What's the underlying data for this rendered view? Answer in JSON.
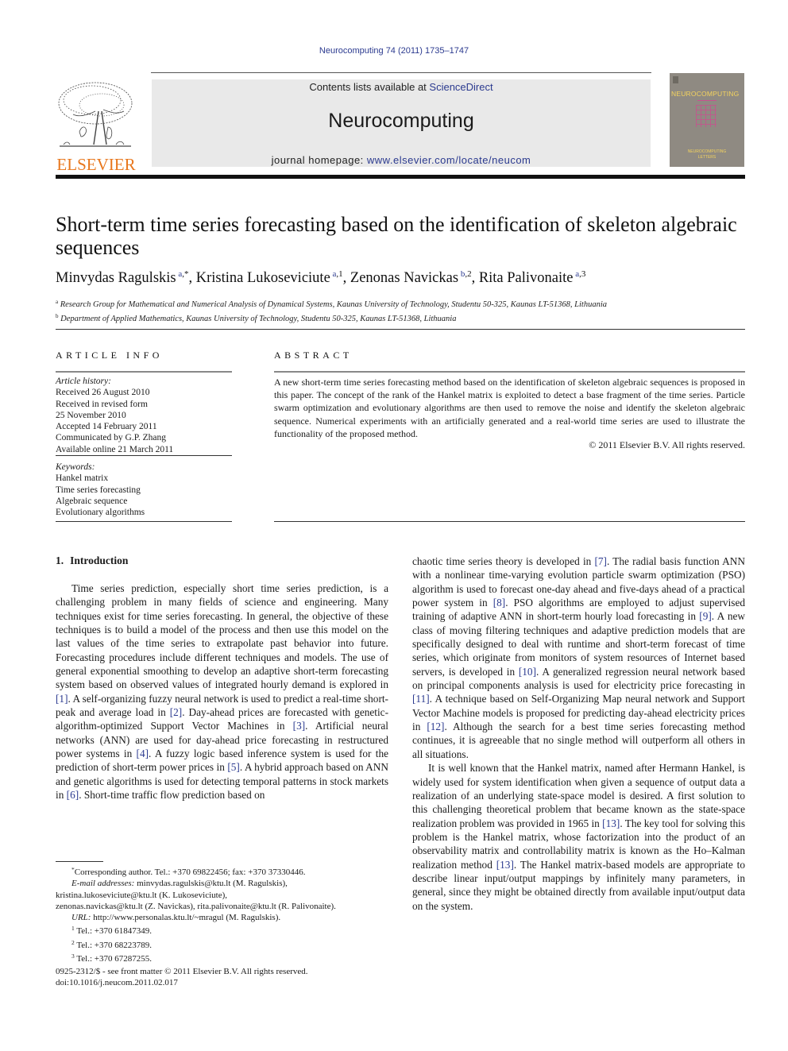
{
  "header": {
    "citation": "Neurocomputing 74 (2011) 1735–1747",
    "contents_prefix": "Contents lists available at ",
    "contents_link": "ScienceDirect",
    "journal_name": "Neurocomputing",
    "homepage_prefix": "journal homepage: ",
    "homepage_link": "www.elsevier.com/locate/neucom",
    "publisher_wordmark": "ELSEVIER",
    "cover": {
      "title": "NEUROCOMPUTING",
      "subtitle_1": "NEUROCOMPUTING",
      "subtitle_2": "LETTERS"
    }
  },
  "article": {
    "title": "Short-term time series forecasting based on the identification of skeleton algebraic sequences",
    "authors": [
      {
        "name": "Minvydas Ragulskis",
        "aff": "a",
        "mark": ",*"
      },
      {
        "name": "Kristina Lukoseviciute",
        "aff": "a",
        "mark": ",1"
      },
      {
        "name": "Zenonas Navickas",
        "aff": "b",
        "mark": ",2"
      },
      {
        "name": "Rita Palivonaite",
        "aff": "a",
        "mark": ",3"
      }
    ],
    "affiliations": [
      {
        "key": "a",
        "text": "Research Group for Mathematical and Numerical Analysis of Dynamical Systems, Kaunas University of Technology, Studentu 50-325, Kaunas LT-51368, Lithuania"
      },
      {
        "key": "b",
        "text": "Department of Applied Mathematics, Kaunas University of Technology, Studentu 50-325, Kaunas LT-51368, Lithuania"
      }
    ]
  },
  "article_info": {
    "heading": "ARTICLE INFO",
    "history_label": "Article history:",
    "history": [
      "Received 26 August 2010",
      "Received in revised form",
      "25 November 2010",
      "Accepted 14 February 2011",
      "Communicated by G.P. Zhang",
      "Available online 21 March 2011"
    ],
    "keywords_label": "Keywords:",
    "keywords": [
      "Hankel matrix",
      "Time series forecasting",
      "Algebraic sequence",
      "Evolutionary algorithms"
    ]
  },
  "abstract": {
    "heading": "ABSTRACT",
    "text": "A new short-term time series forecasting method based on the identification of skeleton algebraic sequences is proposed in this paper. The concept of the rank of the Hankel matrix is exploited to detect a base fragment of the time series. Particle swarm optimization and evolutionary algorithms are then used to remove the noise and identify the skeleton algebraic sequence. Numerical experiments with an artificially generated and a real-world time series are used to illustrate the functionality of the proposed method.",
    "copyright": "© 2011 Elsevier B.V. All rights reserved."
  },
  "section": {
    "number": "1.",
    "title": "Introduction"
  },
  "body": {
    "left_paragraph": [
      {
        "t": "Time series prediction, especially short time series prediction, is a challenging problem in many fields of science and engineer­ing. Many techniques exist for time series forecasting. In general, the objective of these techniques is to build a model of the process and then use this model on the last values of the time series to extrapolate past behavior into future. Forecasting pro­cedures include different techniques and models. The use of general exponential smoothing to develop an adaptive short-term forecasting system based on observed values of integrated hourly demand is explored in "
      },
      {
        "ref": "[1]"
      },
      {
        "t": ". A self-organizing fuzzy neural network is used to predict a real-time short-peak and average load in "
      },
      {
        "ref": "[2]"
      },
      {
        "t": ". Day-ahead prices are forecasted with genetic-algorithm-optimized Support Vector Machines in "
      },
      {
        "ref": "[3]"
      },
      {
        "t": ". Artificial neural networks (ANN) are used for day-ahead price forecasting in restructured power systems in "
      },
      {
        "ref": "[4]"
      },
      {
        "t": ". A fuzzy logic based inference system is used for the prediction of short-term power prices in "
      },
      {
        "ref": "[5]"
      },
      {
        "t": ". A hybrid approach based on ANN and genetic algorithms is used for detecting temporal patterns in stock markets in "
      },
      {
        "ref": "[6]"
      },
      {
        "t": ". Short-time traffic flow prediction based on"
      }
    ],
    "right_paragraph_1": [
      {
        "t": "chaotic time series theory is developed in "
      },
      {
        "ref": "[7]"
      },
      {
        "t": ". The radial basis function ANN with a nonlinear time-varying evolution particle swarm optimization (PSO) algorithm is used to forecast one-day ahead and five-days ahead of a practical power system in "
      },
      {
        "ref": "[8]"
      },
      {
        "t": ". PSO algorithms are employed to adjust supervised training of adaptive ANN in short-term hourly load forecasting in "
      },
      {
        "ref": "[9]"
      },
      {
        "t": ". A new class of moving filtering techniques and adaptive prediction models that are specifically designed to deal with runtime and short-term forecast of time series, which originate from monitors of system resources of Internet based servers, is developed in "
      },
      {
        "ref": "[10]"
      },
      {
        "t": ". A generalized regression neural network based on principal components analysis is used for electricity price forecasting in "
      },
      {
        "ref": "[11]"
      },
      {
        "t": ". A technique based on Self-Organizing Map neural network and Support Vector Machine models is proposed for predicting day-ahead electricity prices in "
      },
      {
        "ref": "[12]"
      },
      {
        "t": ". Although the search for a best time series forecasting method continues, it is agreeable that no single method will outperform all others in all situations."
      }
    ],
    "right_paragraph_2": [
      {
        "t": "It is well known that the Hankel matrix, named after Hermann Hankel, is widely used for system identification when given a sequence of output data a realization of an underlying state-space model is desired. A first solution to this challenging theoretical problem that became known as the state-space realization problem was provided in 1965 in "
      },
      {
        "ref": "[13]"
      },
      {
        "t": ". The key tool for solving this problem is the Hankel matrix, whose factorization into the product of an observability matrix and controllability matrix is known as the Ho–Kalman realization method "
      },
      {
        "ref": "[13]"
      },
      {
        "t": ". The Hankel matrix-based models are appropriate to describe linear input/output mappings by infinitely many parameters, in general, since they might be obtained directly from available input/output data on the system."
      }
    ]
  },
  "footnotes": {
    "corresponding": "Corresponding author. Tel.: +370 69822456; fax: +370 37330446.",
    "email_label": "E-mail addresses:",
    "email_line_1": " minvydas.ragulskis@ktu.lt (M. Ragulskis),",
    "email_line_2": "kristina.lukoseviciute@ktu.lt (K. Lukoseviciute),",
    "email_line_3": "zenonas.navickas@ktu.lt (Z. Navickas), rita.palivonaite@ktu.lt (R. Palivonaite).",
    "url_label": "URL:",
    "url_text": " http://www.personalas.ktu.lt/~mragul (M. Ragulskis).",
    "tel": [
      {
        "mark": "1",
        "text": "Tel.: +370 61847349."
      },
      {
        "mark": "2",
        "text": "Tel.: +370 68223789."
      },
      {
        "mark": "3",
        "text": "Tel.: +370 67287255."
      }
    ]
  },
  "front_matter": {
    "issn_line": "0925-2312/$ - see front matter © 2011 Elsevier B.V. All rights reserved.",
    "doi": "doi:10.1016/j.neucom.2011.02.017"
  }
}
